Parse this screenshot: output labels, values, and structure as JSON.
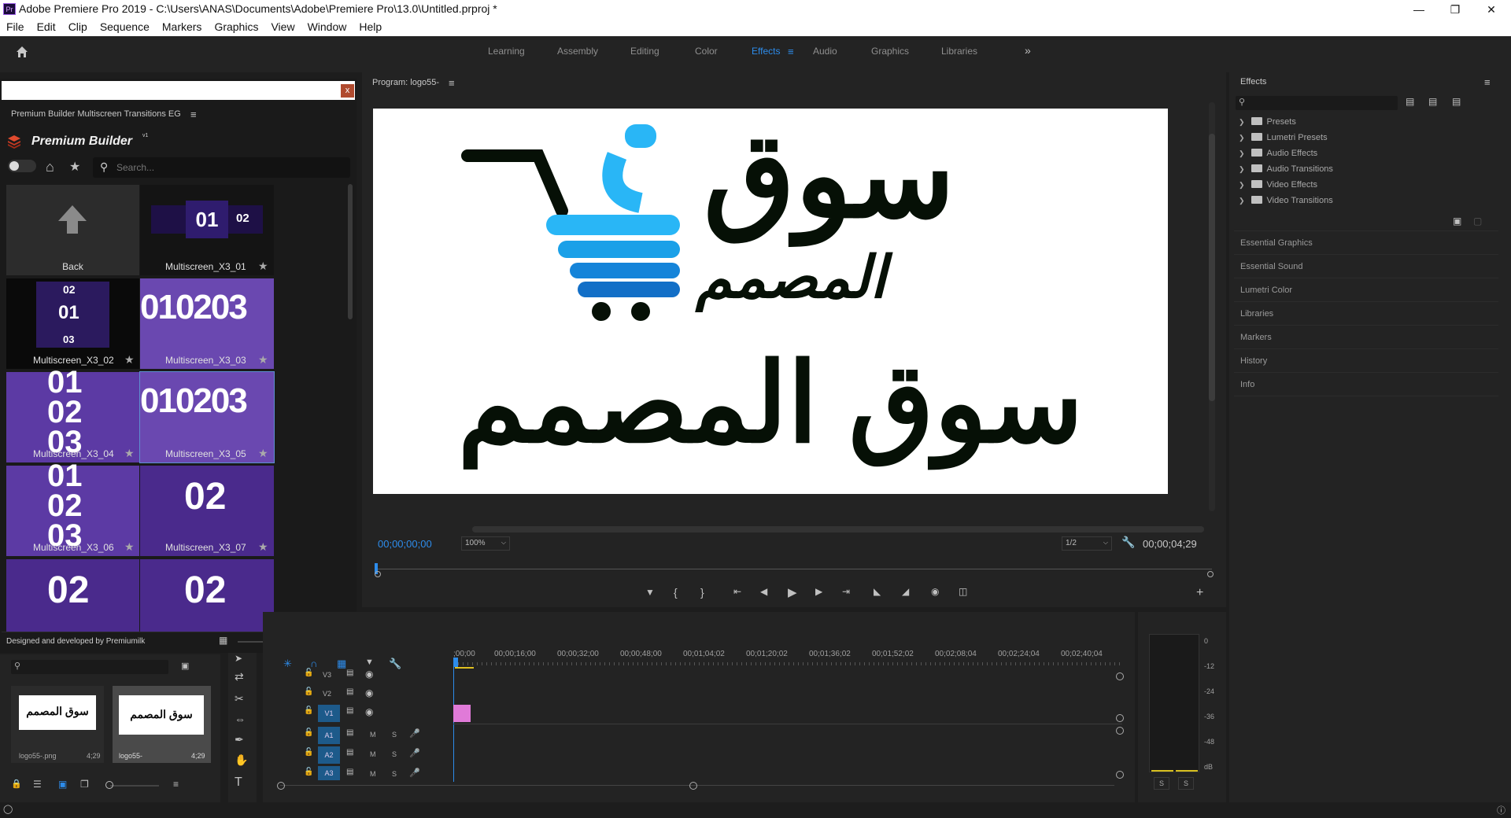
{
  "window": {
    "title": "Adobe Premiere Pro 2019 - C:\\Users\\ANAS\\Documents\\Adobe\\Premiere Pro\\13.0\\Untitled.prproj *",
    "app_icon": "Pr"
  },
  "menu": [
    "File",
    "Edit",
    "Clip",
    "Sequence",
    "Markers",
    "Graphics",
    "View",
    "Window",
    "Help"
  ],
  "workspaces": [
    "Learning",
    "Assembly",
    "Editing",
    "Color",
    "Effects",
    "Audio",
    "Graphics",
    "Libraries"
  ],
  "active_workspace": "Effects",
  "plugin": {
    "tab": "Premium Builder Multiscreen Transitions EG",
    "brand": "Premium Builder",
    "brand_sup": "v1",
    "search_placeholder": "Search...",
    "back_label": "Back",
    "items": [
      {
        "label": "Multiscreen_X3_01",
        "thumb": "01 02"
      },
      {
        "label": "Multiscreen_X3_02",
        "thumb": "02 01 03"
      },
      {
        "label": "Multiscreen_X3_03",
        "thumb": "010203"
      },
      {
        "label": "Multiscreen_X3_04",
        "thumb": "01 02 03"
      },
      {
        "label": "Multiscreen_X3_05",
        "thumb": "010203"
      },
      {
        "label": "Multiscreen_X3_06",
        "thumb": "01 02 03"
      },
      {
        "label": "Multiscreen_X3_07",
        "thumb": "02"
      }
    ],
    "footer": "Designed and developed by Premiumilk"
  },
  "program": {
    "tab": "Program: logo55-",
    "timecode_current": "00;00;00;00",
    "zoom": "100%",
    "resolution": "1/2",
    "timecode_duration": "00;00;04;29",
    "logo_text": "سوق المصمم",
    "logo_text_small": "المصمم"
  },
  "effects": {
    "tab": "Effects",
    "tree": [
      "Presets",
      "Lumetri Presets",
      "Audio Effects",
      "Audio Transitions",
      "Video Effects",
      "Video Transitions"
    ],
    "sections": [
      "Essential Graphics",
      "Essential Sound",
      "Lumetri Color",
      "Libraries",
      "Markers",
      "History",
      "Info"
    ]
  },
  "project": {
    "items": [
      {
        "name": "logo55-.png",
        "duration": "4;29"
      },
      {
        "name": "logo55-",
        "duration": "4;29"
      }
    ]
  },
  "timeline": {
    "ruler": [
      ";00;00",
      "00;00;16;00",
      "00;00;32;00",
      "00;00;48;00",
      "00;01;04;02",
      "00;01;20;02",
      "00;01;36;02",
      "00;01;52;02",
      "00;02;08;04",
      "00;02;24;04",
      "00;02;40;04"
    ],
    "video_tracks": [
      "V3",
      "V2",
      "V1"
    ],
    "audio_tracks": [
      "A1",
      "A2",
      "A3"
    ],
    "mute_label": "M",
    "solo_label": "S"
  },
  "meter": {
    "scale": [
      "0",
      "-12",
      "-24",
      "-36",
      "-48",
      "dB"
    ],
    "solo": [
      "S",
      "S"
    ]
  },
  "colors": {
    "accent": "#2d8ceb",
    "clip": "#e07ad8",
    "logo_blue": "#29b6f6",
    "logo_dark": "#061006"
  }
}
